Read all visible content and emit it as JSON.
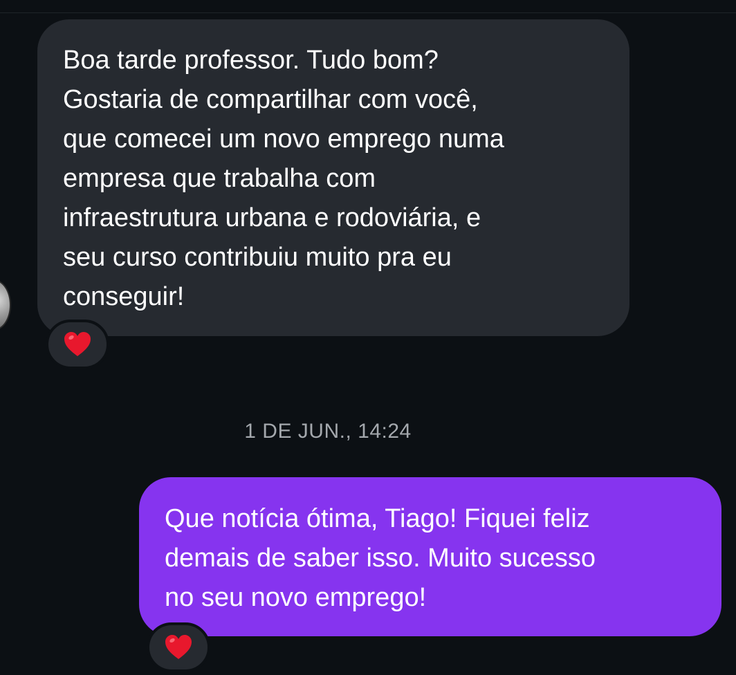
{
  "conversation": {
    "messages": [
      {
        "direction": "received",
        "text": "Boa tarde professor. Tudo bom?\nGostaria de compartilhar com você,\nque comecei um novo emprego numa\nempresa que trabalha com\ninfraestrutura urbana e rodoviária, e\nseu curso contribuiu muito pra eu\nconseguir!",
        "reaction": "heart"
      },
      {
        "direction": "sent",
        "text": "Que notícia ótima, Tiago! Fiquei feliz\ndemais de saber isso. Muito sucesso\nno seu novo emprego!",
        "reaction": "heart"
      }
    ],
    "timestamp": "1 DE JUN., 14:24"
  },
  "colors": {
    "background": "#0c1014",
    "received_bubble": "#262a30",
    "sent_bubble": "#8634ef",
    "heart": "#e8182d",
    "timestamp_text": "#a4a8ad"
  }
}
